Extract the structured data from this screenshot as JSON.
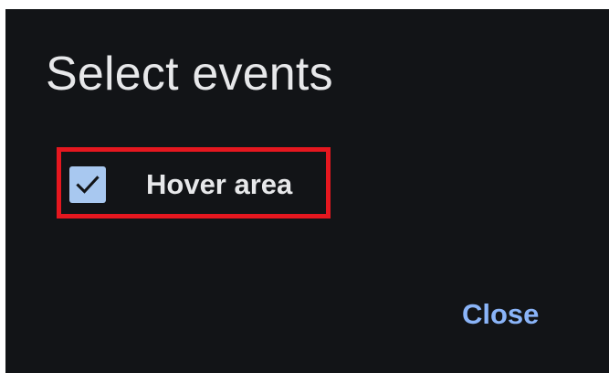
{
  "dialog": {
    "title": "Select events",
    "options": [
      {
        "label": "Hover area",
        "checked": true,
        "icon": "checkmark-icon"
      }
    ],
    "close_label": "Close"
  },
  "colors": {
    "background": "#121417",
    "text": "#e7e8ea",
    "accent": "#8ab4f8",
    "checkbox_fill": "#a8c8f0",
    "highlight": "#e5171f"
  }
}
